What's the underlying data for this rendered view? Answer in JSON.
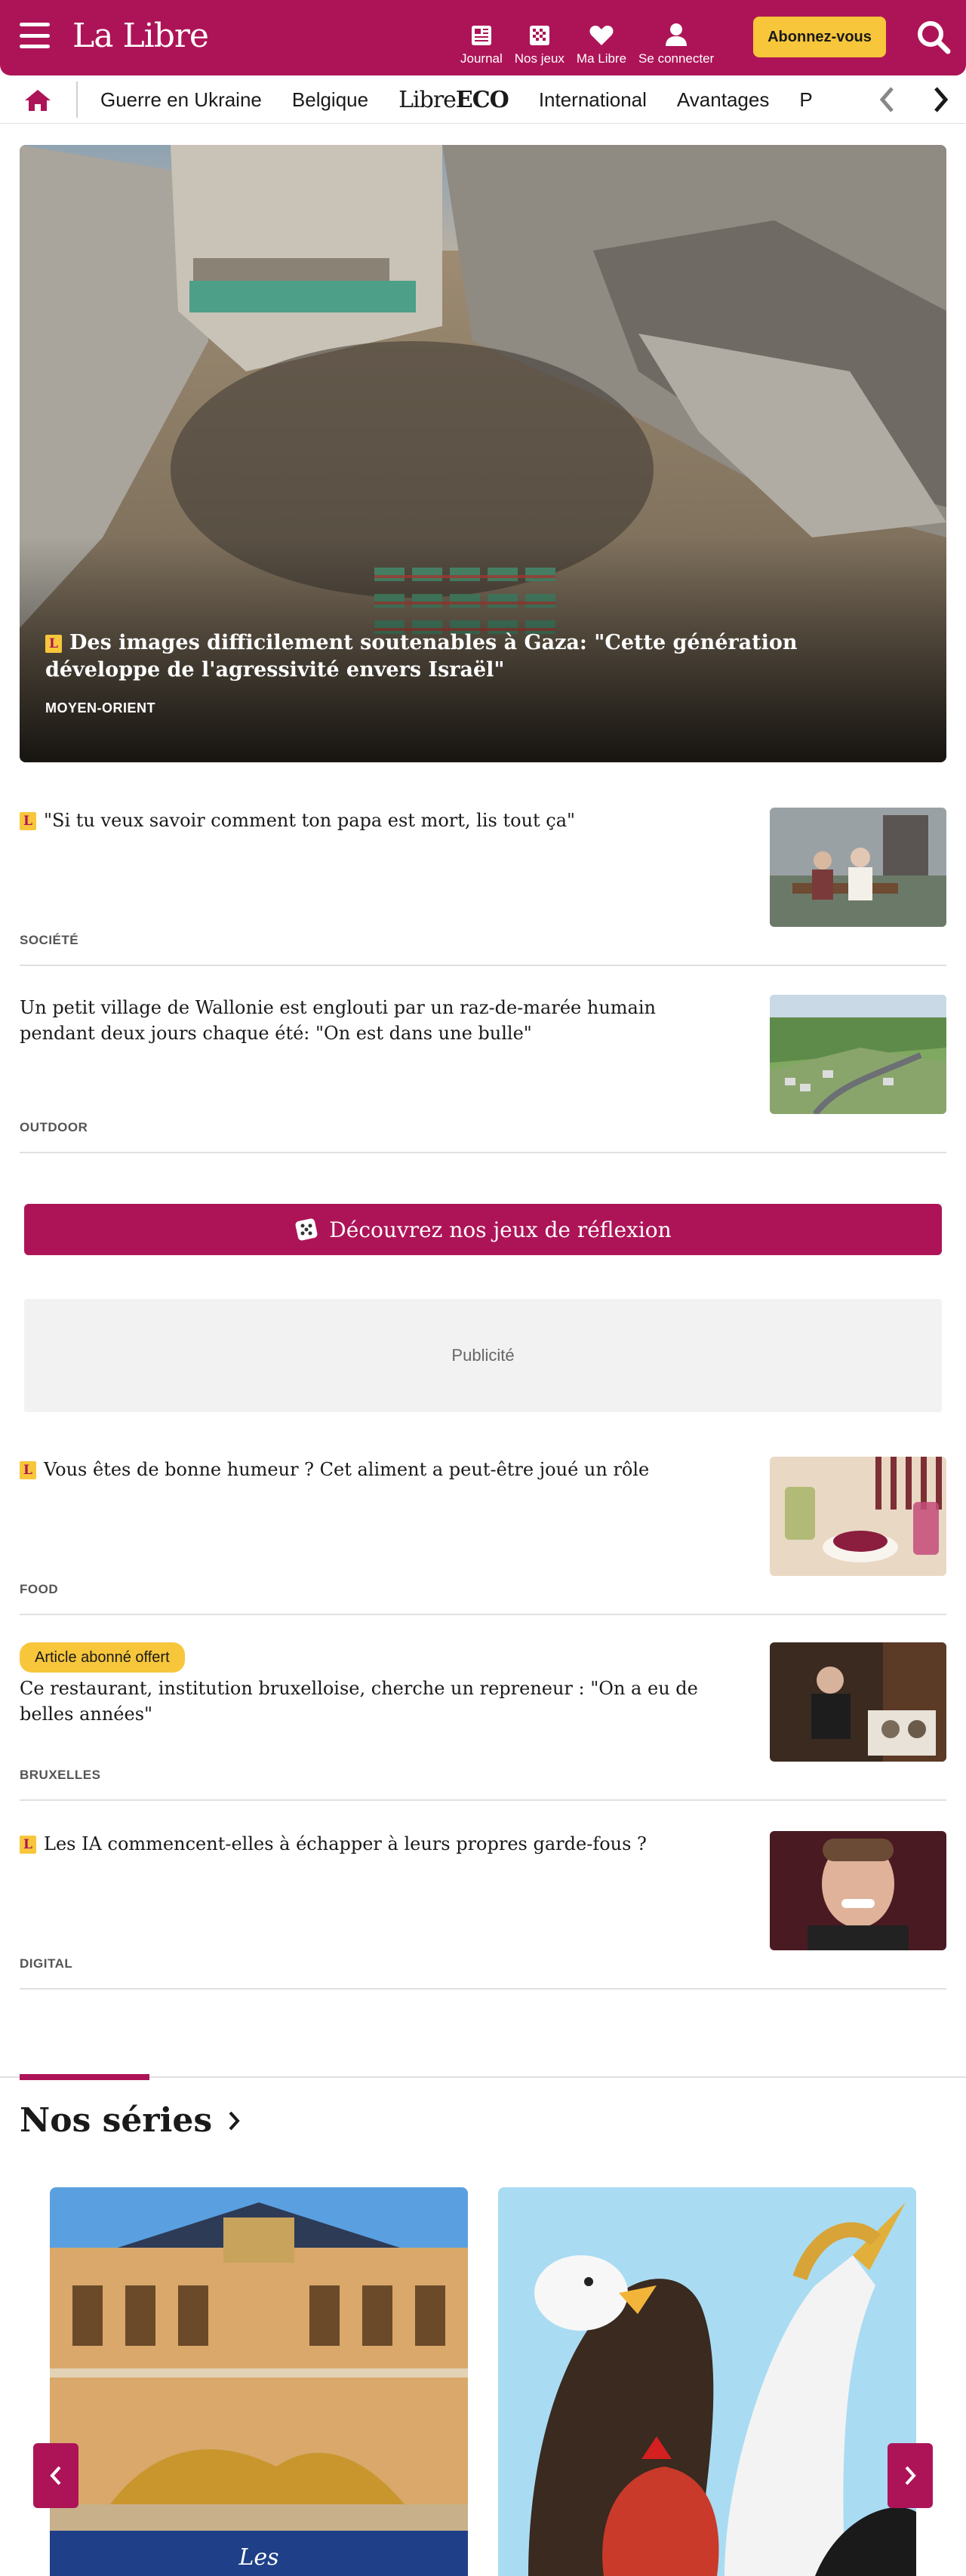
{
  "header": {
    "logo": "La Libre",
    "links": [
      {
        "label": "Journal",
        "icon": "newspaper-icon"
      },
      {
        "label": "Nos jeux",
        "icon": "games-grid-icon"
      },
      {
        "label": "Ma Libre",
        "icon": "heart-icon"
      },
      {
        "label": "Se connecter",
        "icon": "user-icon"
      }
    ],
    "subscribe_label": "Abonnez-vous",
    "search_icon": "search-icon"
  },
  "nav": {
    "items": [
      "Guerre en Ukraine",
      "Belgique",
      "International",
      "Avantages",
      "P"
    ],
    "eco_light": "Libre",
    "eco_bold": "ECO"
  },
  "hero": {
    "title": "Des images difficilement soutenables à Gaza: \"Cette génération développe de l'agressivité envers Israël\"",
    "category": "MOYEN-ORIENT",
    "badge": "L"
  },
  "articles": [
    {
      "title": "\"Si tu veux savoir comment ton papa est mort, lis tout ça\"",
      "category": "SOCIÉTÉ",
      "badge": "L"
    },
    {
      "title": "Un petit village de Wallonie est englouti par un raz-de-marée humain pendant deux jours chaque été: \"On est dans une bulle\"",
      "category": "OUTDOOR"
    },
    {
      "title": "Vous êtes de bonne humeur ? Cet aliment a peut-être joué un rôle",
      "category": "FOOD",
      "badge": "L"
    },
    {
      "title": "Ce restaurant, institution bruxelloise, cherche un repreneur : \"On a eu de belles années\"",
      "category": "BRUXELLES",
      "offer": "Article abonné offert"
    },
    {
      "title": "Les IA commencent-elles à échapper à leurs propres garde-fous ?",
      "category": "DIGITAL",
      "badge": "L"
    }
  ],
  "games_banner": "Découvrez nos jeux de réflexion",
  "ad_label": "Publicité",
  "series": {
    "title": "Nos séries",
    "card_caption": "Les"
  },
  "colors": {
    "brand": "#ad1457",
    "accent": "#f7c63b"
  }
}
